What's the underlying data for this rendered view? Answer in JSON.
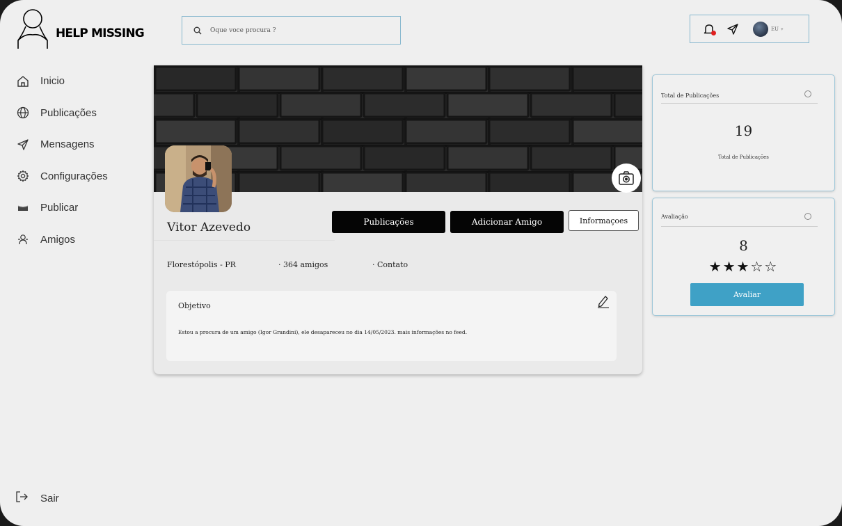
{
  "app": {
    "name": "HELP MISSING"
  },
  "sidebar": {
    "items": [
      {
        "label": "Inicio",
        "icon": "home-icon"
      },
      {
        "label": "Publicações",
        "icon": "globe-icon"
      },
      {
        "label": "Mensagens",
        "icon": "send-icon"
      },
      {
        "label": "Configurações",
        "icon": "gear-icon"
      },
      {
        "label": "Publicar",
        "icon": "tray-icon"
      },
      {
        "label": "Amigos",
        "icon": "friends-icon"
      }
    ],
    "logout_label": "Sair"
  },
  "search": {
    "placeholder": "Oque voce procura ?"
  },
  "topbar": {
    "user_label": "EU"
  },
  "profile": {
    "name": "Vitor Azevedo",
    "location": "Florestópolis - PR",
    "friends": "· 364 amigos",
    "contact": "· Contato",
    "buttons": {
      "posts": "Publicações",
      "add_friend": "Adicionar Amigo",
      "info": "Informaçoes"
    }
  },
  "objective": {
    "title": "Objetivo",
    "text": "Estou a procura de um amigo (Igor Grandini), ele desapareceu no dia 14/05/2023. mais informações no feed."
  },
  "stats": {
    "posts": {
      "title": "Total de Publicações",
      "value": "19",
      "subtitle": "Total de Publicações"
    },
    "rating": {
      "title": "Avaliação",
      "value": "8",
      "stars": "★★★☆☆",
      "filled_stars": 3,
      "max_stars": 5,
      "button": "Avaliar"
    }
  },
  "colors": {
    "accent": "#3fa1c6",
    "border": "#86b7ce",
    "notification": "#e02020"
  }
}
